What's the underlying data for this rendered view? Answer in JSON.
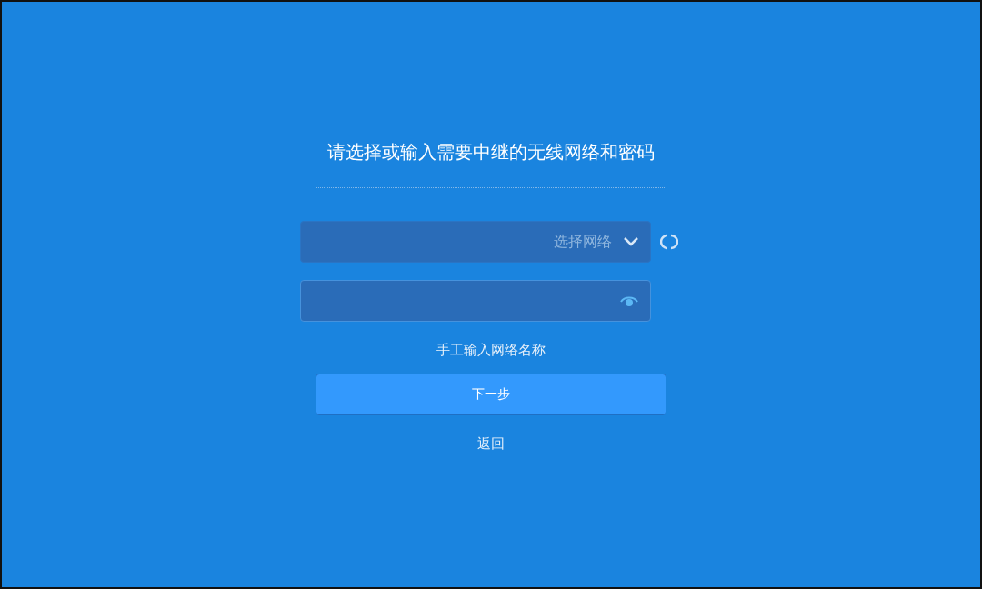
{
  "title": "请选择或输入需要中继的无线网络和密码",
  "network_select": {
    "placeholder": "选择网络"
  },
  "password_field": {
    "password_visible": false
  },
  "manual_link": "手工输入网络名称",
  "next_button": "下一步",
  "back_link": "返回"
}
